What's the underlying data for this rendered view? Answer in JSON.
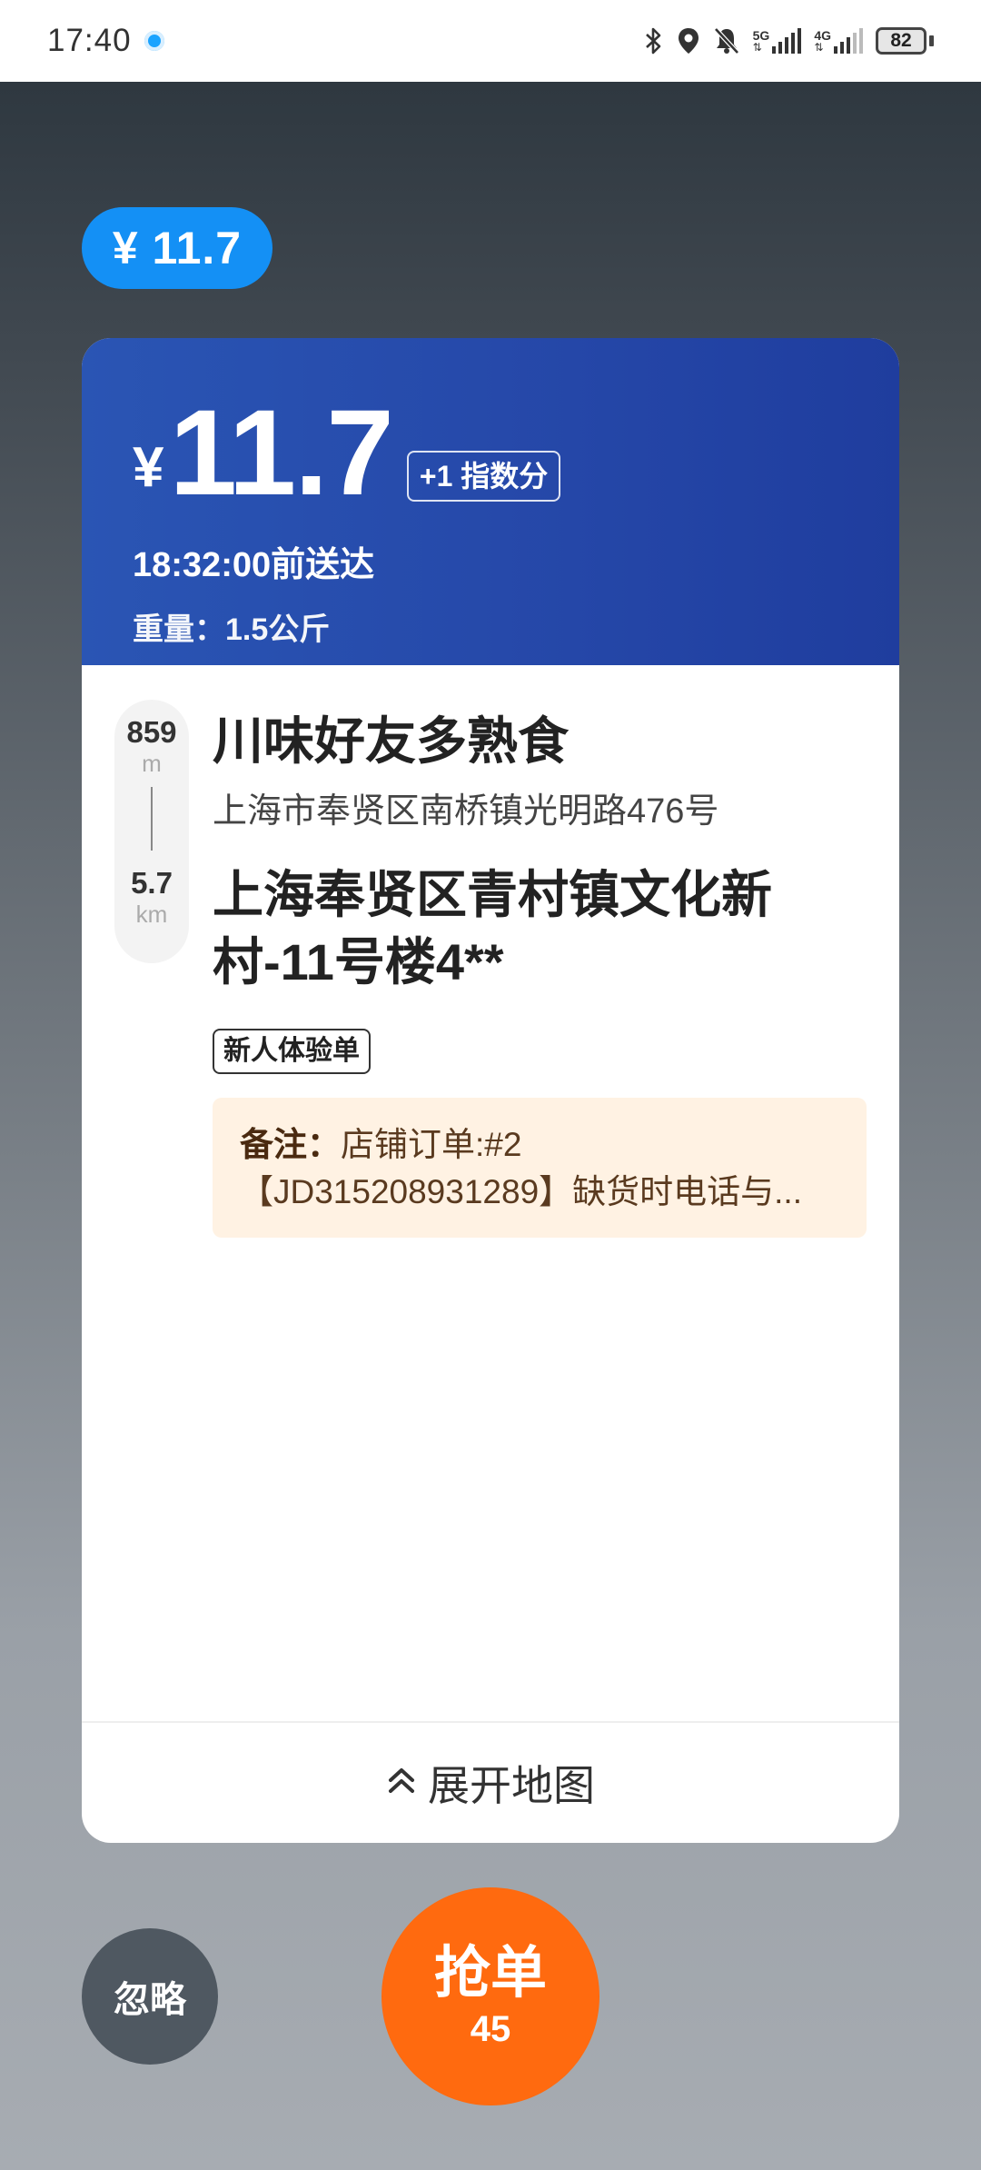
{
  "status_bar": {
    "time": "17:40",
    "net_5g": "5G",
    "net_4g": "4G",
    "battery": "82",
    "icons": [
      "bluetooth-icon",
      "location-icon",
      "mute-icon",
      "signal-5g-icon",
      "signal-4g-icon",
      "battery-icon"
    ]
  },
  "order": {
    "price_pill": "¥ 11.7",
    "currency": "¥",
    "price": "11.7",
    "bonus": "+1 指数分",
    "deadline": "18:32:00前送达",
    "weight": "重量：1.5公斤",
    "route": {
      "pickup_distance": "859",
      "pickup_unit": "m",
      "delivery_distance": "5.7",
      "delivery_unit": "km"
    },
    "shop_name": "川味好友多熟食",
    "shop_address": "上海市奉贤区南桥镇光明路476号",
    "destination": "上海奉贤区青村镇文化新村-11号楼4**",
    "tag": "新人体验单",
    "note_label": "备注：",
    "note_line1": "店铺订单:#2",
    "note_line2": "【JD315208931289】缺货时电话与..."
  },
  "map_toggle": {
    "label": "展开地图",
    "icon": "chevron-up-double-icon"
  },
  "actions": {
    "ignore": "忽略",
    "grab": "抢单",
    "grab_count": "45"
  },
  "colors": {
    "accent_blue": "#1490f5",
    "header_blue": "#2547a8",
    "grab_orange": "#ff6a0f",
    "ignore_gray": "#4f5861",
    "note_bg": "#fff2e3"
  }
}
